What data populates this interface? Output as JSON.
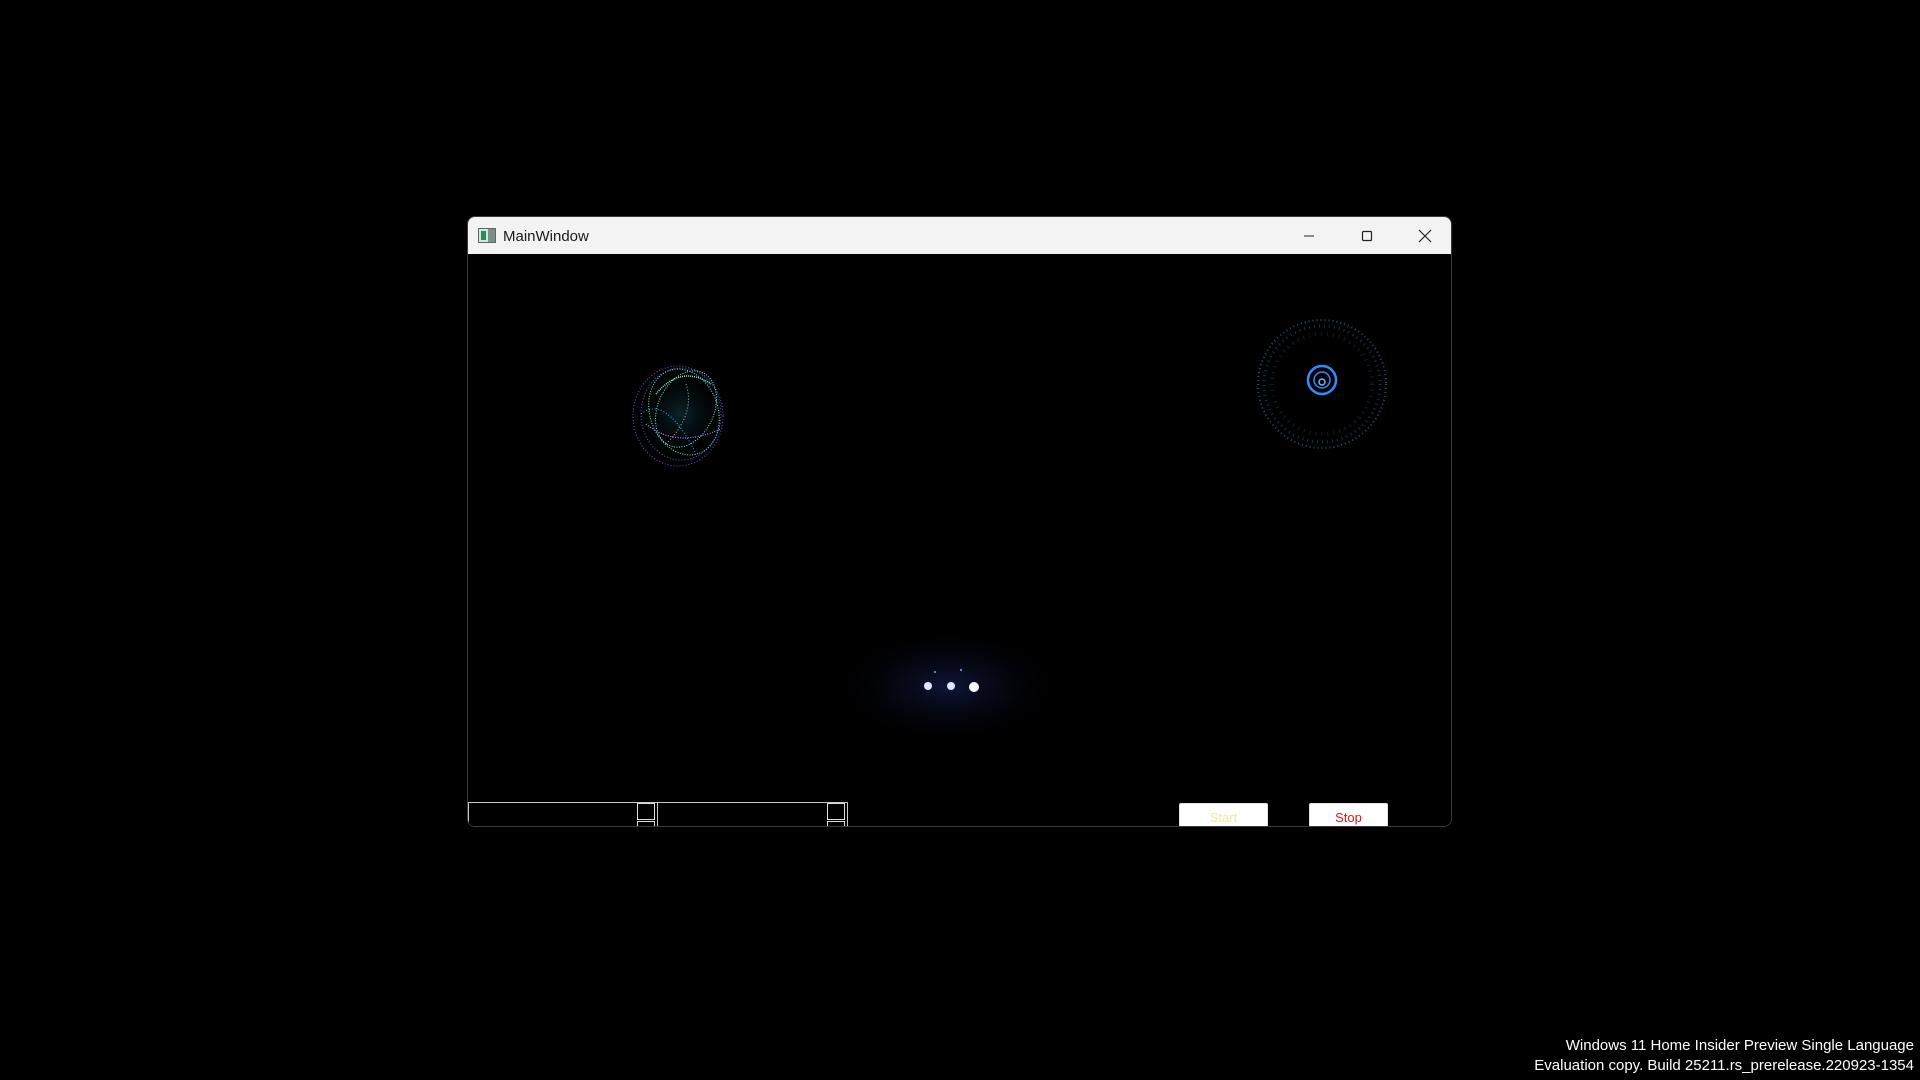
{
  "window": {
    "title": "MainWindow",
    "controls": {
      "minimize_icon": "minimize-icon",
      "maximize_icon": "maximize-icon",
      "close_icon": "close-icon"
    }
  },
  "content": {
    "spinboxes": [
      {
        "value": ""
      },
      {
        "value": ""
      }
    ],
    "start_label": "Start",
    "stop_label": "Stop",
    "visuals": {
      "left": "particle-sphere-icon",
      "right": "particle-ring-icon",
      "center": "audio-wave-icon"
    }
  },
  "watermark": {
    "line1": "Windows 11 Home Insider Preview Single Language",
    "line2": "Evaluation copy. Build 25211.rs_prerelease.220923-1354"
  },
  "colors": {
    "background": "#000000",
    "titlebar": "#f3f3f3",
    "start_text": "#f2e6a0",
    "stop_text": "#e0141e",
    "accent_blue": "#2f8dff",
    "accent_cyan": "#4fe0c8",
    "accent_purple": "#8a4cff"
  }
}
